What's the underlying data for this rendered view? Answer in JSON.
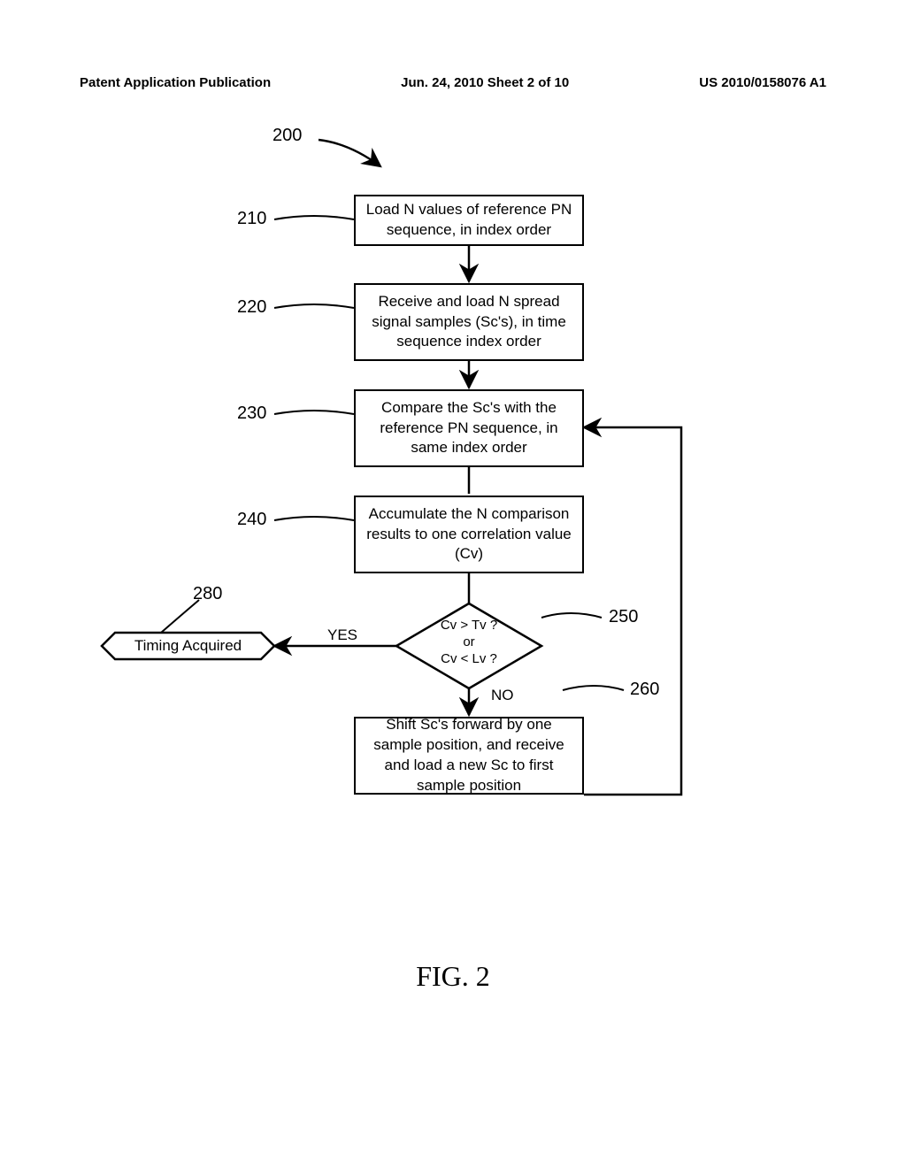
{
  "header": {
    "left": "Patent Application Publication",
    "center": "Jun. 24, 2010  Sheet 2 of 10",
    "right": "US 2010/0158076 A1"
  },
  "figure_label": "FIG. 2",
  "refs": {
    "r200": "200",
    "r210": "210",
    "r220": "220",
    "r230": "230",
    "r240": "240",
    "r250": "250",
    "r260": "260",
    "r280": "280"
  },
  "boxes": {
    "b210": "Load N values of reference PN sequence, in index order",
    "b220": "Receive and load N spread signal samples (Sc's), in time sequence index order",
    "b230": "Compare the Sc's with the reference PN sequence, in same index order",
    "b240": "Accumulate the N comparison results to one correlation value (Cv)",
    "b260": "Shift Sc's forward by one sample position, and receive and load a new Sc to first sample position",
    "b280": "Timing Acquired"
  },
  "decision": {
    "line1": "Cv > Tv ?",
    "line2": "or",
    "line3": "Cv < Lv ?"
  },
  "labels": {
    "yes": "YES",
    "no": "NO"
  },
  "chart_data": {
    "type": "flowchart",
    "title": "FIG. 2",
    "nodes": [
      {
        "id": 200,
        "type": "start-marker",
        "label": "200"
      },
      {
        "id": 210,
        "type": "process",
        "text": "Load N values of reference PN sequence, in index order"
      },
      {
        "id": 220,
        "type": "process",
        "text": "Receive and load N spread signal samples (Sc's), in time sequence index order"
      },
      {
        "id": 230,
        "type": "process",
        "text": "Compare the Sc's with the reference PN sequence, in same index order"
      },
      {
        "id": 240,
        "type": "process",
        "text": "Accumulate the N comparison results to one correlation value (Cv)"
      },
      {
        "id": 250,
        "type": "decision",
        "text": "Cv > Tv ? or Cv < Lv ?"
      },
      {
        "id": 260,
        "type": "process",
        "text": "Shift Sc's forward by one sample position, and receive and load a new Sc to first sample position"
      },
      {
        "id": 280,
        "type": "terminator",
        "text": "Timing Acquired"
      }
    ],
    "edges": [
      {
        "from": 210,
        "to": 220
      },
      {
        "from": 220,
        "to": 230
      },
      {
        "from": 230,
        "to": 240
      },
      {
        "from": 240,
        "to": 250
      },
      {
        "from": 250,
        "to": 280,
        "label": "YES"
      },
      {
        "from": 250,
        "to": 260,
        "label": "NO"
      },
      {
        "from": 260,
        "to": 230,
        "label": "loop"
      }
    ]
  }
}
